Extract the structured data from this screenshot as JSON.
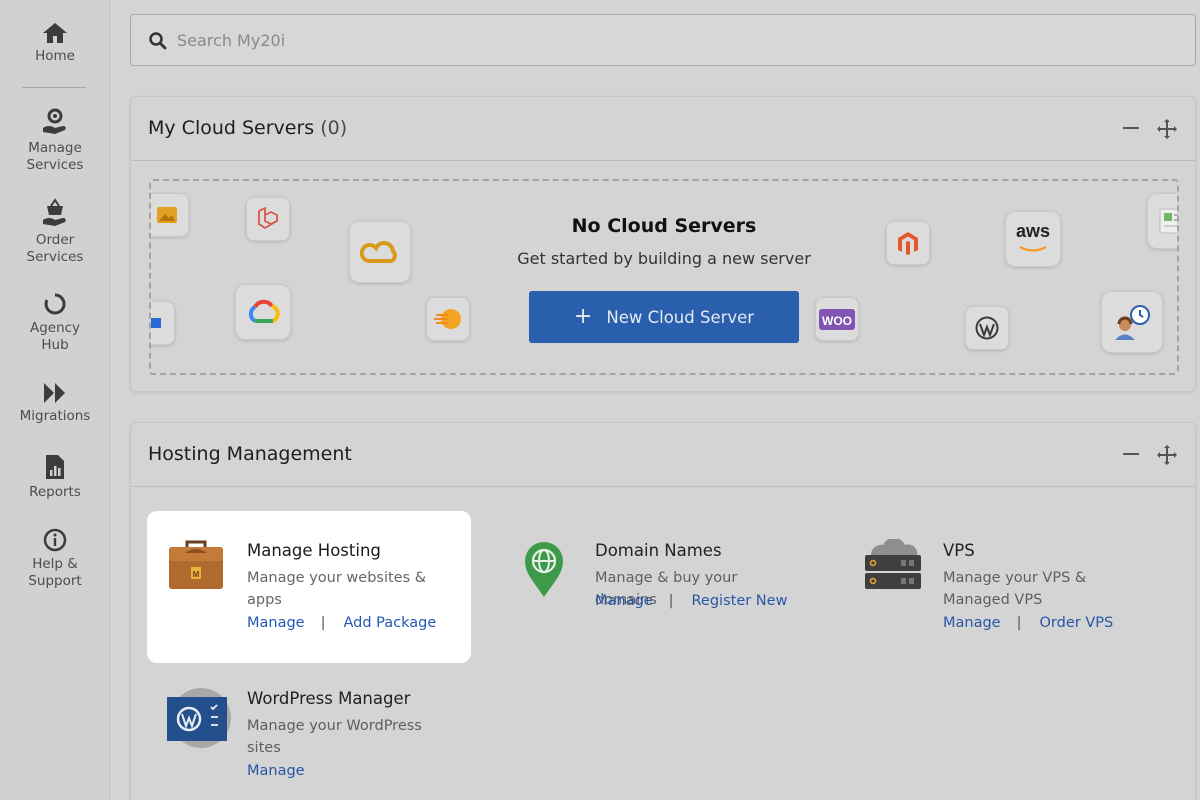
{
  "sidebar": {
    "items": [
      {
        "label_line1": "Home",
        "label_line2": "",
        "icon": "home-icon"
      },
      {
        "label_line1": "Manage",
        "label_line2": "Services",
        "icon": "gear-hand-icon"
      },
      {
        "label_line1": "Order",
        "label_line2": "Services",
        "icon": "basket-hand-icon"
      },
      {
        "label_line1": "Agency",
        "label_line2": "Hub",
        "icon": "circle-arrow-icon"
      },
      {
        "label_line1": "Migrations",
        "label_line2": "",
        "icon": "double-chevron-icon"
      },
      {
        "label_line1": "Reports",
        "label_line2": "",
        "icon": "report-icon"
      },
      {
        "label_line1": "Help &",
        "label_line2": "Support",
        "icon": "info-icon"
      }
    ]
  },
  "search": {
    "placeholder": "Search My20i"
  },
  "cloud_panel": {
    "title": "My Cloud Servers",
    "count": "(0)",
    "empty_title": "No Cloud Servers",
    "empty_subtitle": "Get started by building a new server",
    "button_label": "New Cloud Server",
    "logo_tiles": [
      "image",
      "laravel",
      "cloud",
      "google-cloud",
      "sitebuilder",
      "magento",
      "aws",
      "woo",
      "wordpress",
      "support-agent",
      "browser"
    ],
    "aws_text": "aws",
    "woo_text": "WOO"
  },
  "hosting_panel": {
    "title": "Hosting Management",
    "cards": [
      {
        "title": "Manage Hosting",
        "desc": "Manage your websites & apps",
        "link1": "Manage",
        "link2": "Add Package"
      },
      {
        "title": "Domain Names",
        "desc": "Manage & buy your domains",
        "link1": "Manage",
        "link2": "Register New"
      },
      {
        "title": "VPS",
        "desc": "Manage your VPS & Managed VPS",
        "link1": "Manage",
        "link2": "Order VPS"
      },
      {
        "title": "WordPress Manager",
        "desc": "Manage your WordPress sites",
        "link1": "Manage"
      }
    ]
  },
  "colors": {
    "accent": "#2a5fad",
    "link": "#2557b5",
    "background": "#d4d4d4",
    "highlight_card": "#ffffff"
  }
}
